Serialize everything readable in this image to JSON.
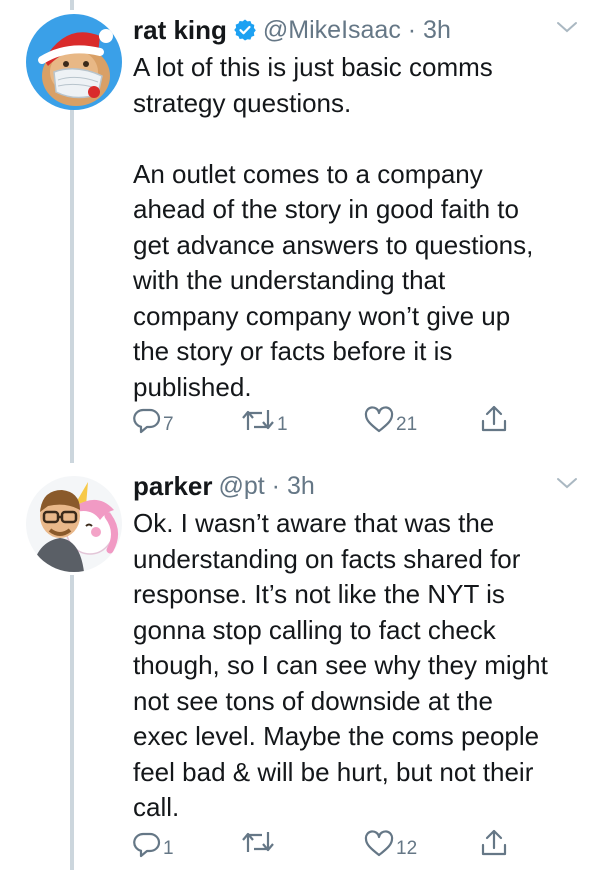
{
  "tweets": [
    {
      "name": "rat king",
      "handle": "@MikeIsaac · 3h",
      "verified": true,
      "text": "A lot of this is just basic comms\nstrategy questions.\n\nAn outlet comes to a company\nahead of the story in good faith to\nget advance answers to questions,\nwith the understanding that\ncompany company won’t give up\nthe story or facts before it is\npublished.",
      "reply_count": "7",
      "retweet_count": "1",
      "like_count": "21"
    },
    {
      "name": "parker",
      "handle": "@pt · 3h",
      "verified": false,
      "text": "Ok. I wasn’t aware that was the\nunderstanding on facts shared for\nresponse. It’s not like the NYT is\ngonna stop calling to fact check\nthough, so I can see why they might\nnot see tons of downside at the\nexec level. Maybe the coms people\nfeel bad & will be hurt, but not their\ncall.",
      "reply_count": "1",
      "retweet_count": "",
      "like_count": "12"
    }
  ],
  "colors": {
    "accent": "#1da1f2",
    "muted": "#657786",
    "thread_line": "#ccd6dd"
  }
}
